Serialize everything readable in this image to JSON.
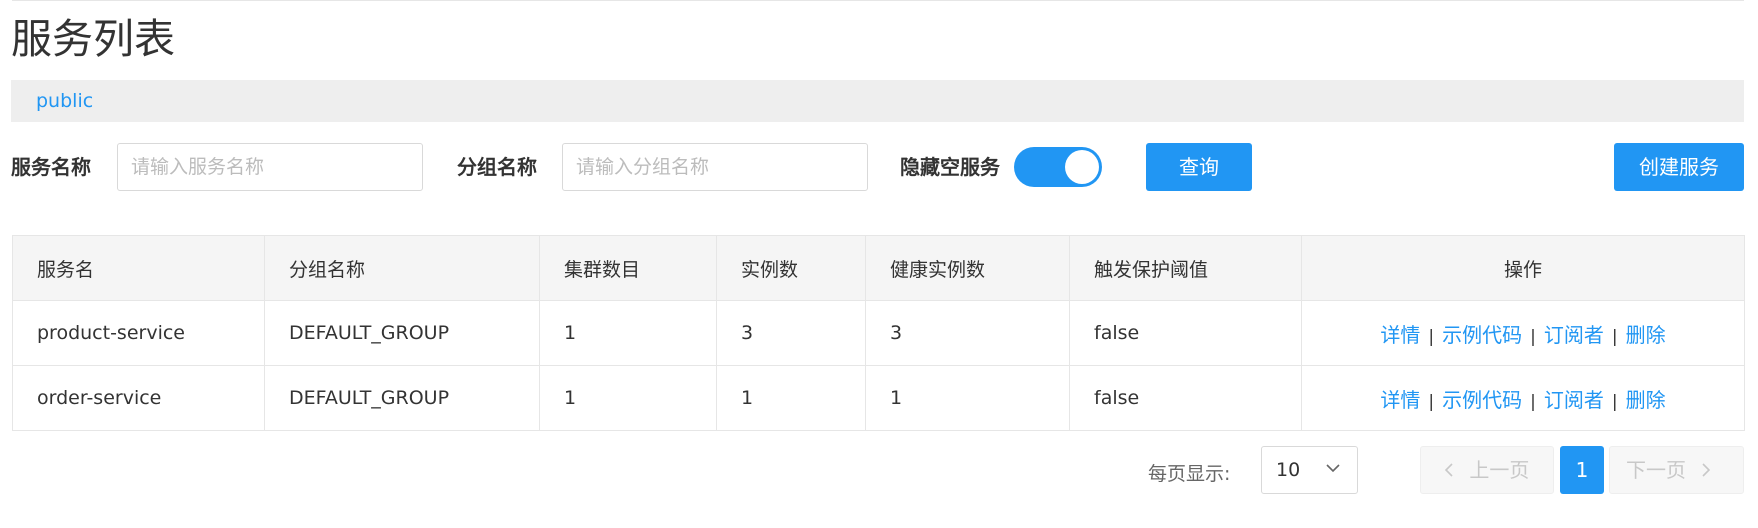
{
  "page": {
    "title": "服务列表"
  },
  "namespace": {
    "current": "public"
  },
  "filters": {
    "service_name_label": "服务名称",
    "service_name_placeholder": "请输入服务名称",
    "group_name_label": "分组名称",
    "group_name_placeholder": "请输入分组名称",
    "hide_empty_label": "隐藏空服务",
    "hide_empty_on": true,
    "query_label": "查询",
    "create_label": "创建服务"
  },
  "table": {
    "headers": [
      "服务名",
      "分组名称",
      "集群数目",
      "实例数",
      "健康实例数",
      "触发保护阈值",
      "操作"
    ],
    "rows": [
      {
        "service": "product-service",
        "group": "DEFAULT_GROUP",
        "clusters": "1",
        "instances": "3",
        "healthy": "3",
        "protect": "false"
      },
      {
        "service": "order-service",
        "group": "DEFAULT_GROUP",
        "clusters": "1",
        "instances": "1",
        "healthy": "1",
        "protect": "false"
      }
    ],
    "actions": {
      "detail": "详情",
      "sample_code": "示例代码",
      "subscribers": "订阅者",
      "delete": "删除",
      "separator": "|"
    }
  },
  "pagination": {
    "page_size_label": "每页显示:",
    "page_size": "10",
    "prev_label": "上一页",
    "next_label": "下一页",
    "current_page": "1"
  },
  "colors": {
    "accent": "#2196f3",
    "header_bg": "#f5f5f5",
    "namespace_bar_bg": "#eeeeee"
  },
  "icons": {
    "page_size_dropdown": "chevron-down-icon",
    "prev": "chevron-left-icon",
    "next": "chevron-right-icon"
  }
}
